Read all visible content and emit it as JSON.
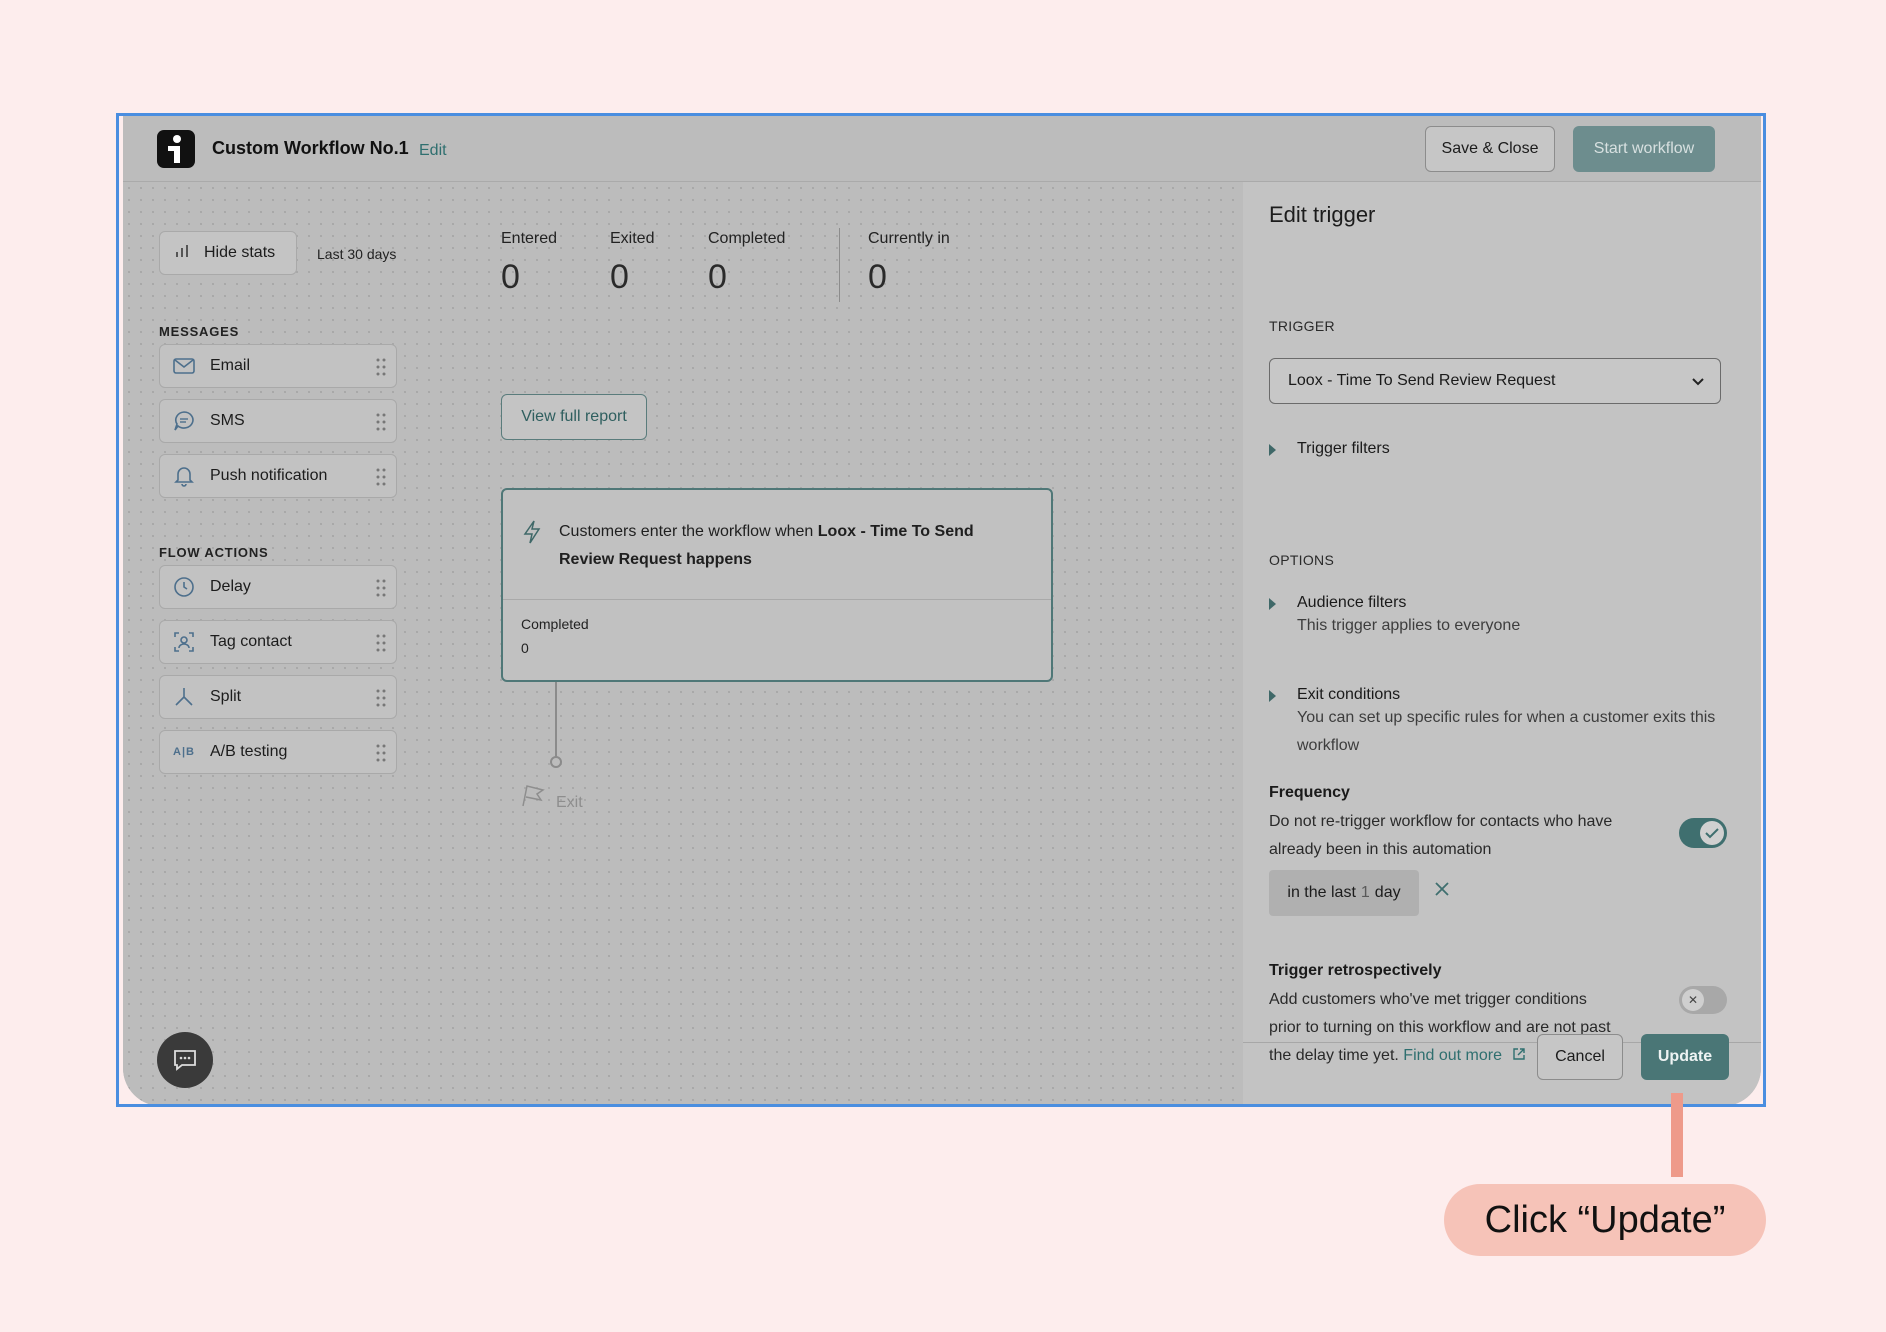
{
  "header": {
    "title": "Custom Workflow No.1",
    "edit_label": "Edit",
    "save_close_label": "Save & Close",
    "start_label": "Start workflow"
  },
  "sidebar": {
    "hide_stats_label": "Hide stats",
    "range_label": "Last 30 days",
    "messages_heading": "MESSAGES",
    "messages": [
      {
        "label": "Email",
        "icon": "envelope-icon"
      },
      {
        "label": "SMS",
        "icon": "chat-bubble-icon"
      },
      {
        "label": "Push notification",
        "icon": "bell-icon"
      }
    ],
    "flow_heading": "FLOW ACTIONS",
    "flow_actions": [
      {
        "label": "Delay",
        "icon": "clock-icon"
      },
      {
        "label": "Tag contact",
        "icon": "tag-contact-icon"
      },
      {
        "label": "Split",
        "icon": "split-icon"
      },
      {
        "label": "A/B testing",
        "icon": "ab-testing-icon"
      }
    ]
  },
  "stats": {
    "entered_label": "Entered",
    "entered_value": "0",
    "exited_label": "Exited",
    "exited_value": "0",
    "completed_label": "Completed",
    "completed_value": "0",
    "currently_label": "Currently in",
    "currently_value": "0",
    "view_report_label": "View full report"
  },
  "trigger_card": {
    "text_prefix": "Customers enter the workflow when ",
    "text_bold": "Loox - Time To Send Review Request happens",
    "completed_label": "Completed",
    "completed_value": "0"
  },
  "exit_label": "Exit",
  "panel": {
    "title": "Edit trigger",
    "trigger_heading": "TRIGGER",
    "trigger_value": "Loox - Time To Send Review Request",
    "trigger_filters_label": "Trigger filters",
    "options_heading": "OPTIONS",
    "audience_label": "Audience filters",
    "audience_desc": "This trigger applies to everyone",
    "exit_label": "Exit conditions",
    "exit_desc": "You can set up specific rules for when a customer exits this workflow",
    "frequency_title": "Frequency",
    "frequency_desc": "Do not re-trigger workflow for contacts who have already been in this automation",
    "frequency_enabled": true,
    "chip_prefix": "in the last",
    "chip_number": "1",
    "chip_unit": "day",
    "retro_title": "Trigger retrospectively",
    "retro_desc": "Add customers who've met trigger conditions prior to turning on this workflow and are not past the delay time yet.",
    "retro_link": "Find out more",
    "retro_enabled": false,
    "cancel_label": "Cancel",
    "update_label": "Update"
  },
  "callout": {
    "text": "Click “Update”"
  },
  "colors": {
    "accent": "#4a7676",
    "frame_border": "#4a8ee0",
    "callout": "#f6c3b8",
    "page_bg": "#fdeded"
  }
}
